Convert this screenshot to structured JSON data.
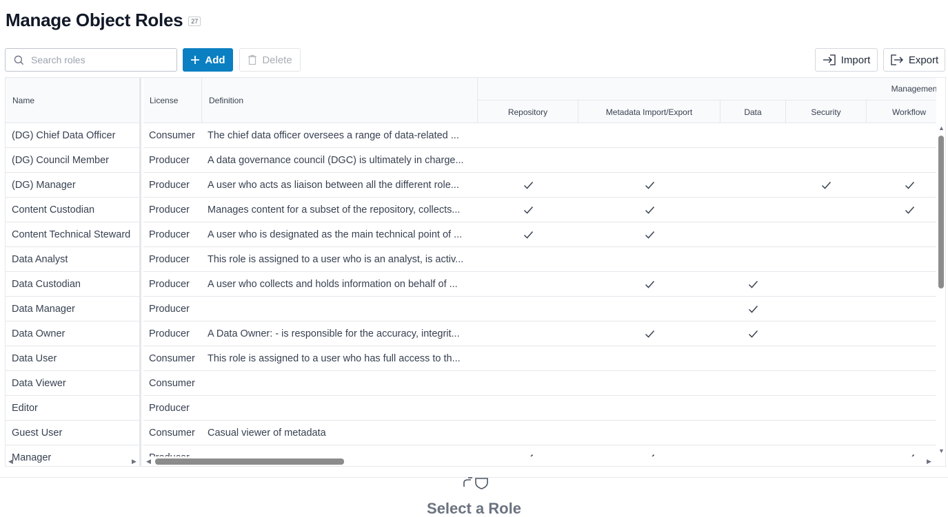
{
  "header": {
    "title": "Manage Object Roles",
    "count": "27"
  },
  "toolbar": {
    "search_placeholder": "Search roles",
    "add_label": "Add",
    "delete_label": "Delete",
    "import_label": "Import",
    "export_label": "Export"
  },
  "table": {
    "columns": {
      "name": "Name",
      "license": "License",
      "definition": "Definition",
      "group": "Management (P",
      "sub": [
        "Repository",
        "Metadata Import/Export",
        "Data",
        "Security",
        "Workflow"
      ]
    },
    "rows": [
      {
        "name": "(DG) Chief Data Officer",
        "license": "Consumer",
        "definition": "The chief data officer oversees a range of data-related ...",
        "checks": [
          false,
          false,
          false,
          false,
          false
        ]
      },
      {
        "name": "(DG) Council Member",
        "license": "Producer",
        "definition": "A data governance council (DGC) is ultimately in charge...",
        "checks": [
          false,
          false,
          false,
          false,
          false
        ]
      },
      {
        "name": "(DG) Manager",
        "license": "Producer",
        "definition": "A user who acts as liaison between all the different role...",
        "checks": [
          true,
          true,
          false,
          true,
          true
        ]
      },
      {
        "name": "Content Custodian",
        "license": "Producer",
        "definition": "Manages content for a subset of the repository, collects...",
        "checks": [
          true,
          true,
          false,
          false,
          true
        ]
      },
      {
        "name": "Content Technical Steward",
        "license": "Producer",
        "definition": "A user who is designated as the main technical point of ...",
        "checks": [
          true,
          true,
          false,
          false,
          false
        ]
      },
      {
        "name": "Data Analyst",
        "license": "Producer",
        "definition": "This role is assigned to a user who is an analyst, is activ...",
        "checks": [
          false,
          false,
          false,
          false,
          false
        ]
      },
      {
        "name": "Data Custodian",
        "license": "Producer",
        "definition": "A user who collects and holds information on behalf of ...",
        "checks": [
          false,
          true,
          true,
          false,
          false
        ]
      },
      {
        "name": "Data Manager",
        "license": "Producer",
        "definition": "",
        "checks": [
          false,
          false,
          true,
          false,
          false
        ]
      },
      {
        "name": "Data Owner",
        "license": "Producer",
        "definition": "A Data Owner: - is responsible for the accuracy, integrit...",
        "checks": [
          false,
          true,
          true,
          false,
          false
        ]
      },
      {
        "name": "Data User",
        "license": "Consumer",
        "definition": "This role is assigned to a user who has full access to th...",
        "checks": [
          false,
          false,
          false,
          false,
          false
        ]
      },
      {
        "name": "Data Viewer",
        "license": "Consumer",
        "definition": "",
        "checks": [
          false,
          false,
          false,
          false,
          false
        ]
      },
      {
        "name": "Editor",
        "license": "Producer",
        "definition": "",
        "checks": [
          false,
          false,
          false,
          false,
          false
        ]
      },
      {
        "name": "Guest User",
        "license": "Consumer",
        "definition": "Casual viewer of metadata",
        "checks": [
          false,
          false,
          false,
          false,
          false
        ]
      },
      {
        "name": "Manager",
        "license": "Producer",
        "definition": "",
        "checks": [
          true,
          true,
          false,
          false,
          true
        ]
      }
    ]
  },
  "detail": {
    "empty_label": "Select a Role"
  },
  "icons": {
    "search": "search-icon",
    "add": "plus-icon",
    "delete": "trash-icon",
    "import": "import-icon",
    "export": "export-icon",
    "check": "check-icon",
    "role": "role-shield-icon"
  },
  "colors": {
    "accent": "#0a7fc2",
    "border": "#e5e7eb",
    "muted": "#6b7280"
  }
}
